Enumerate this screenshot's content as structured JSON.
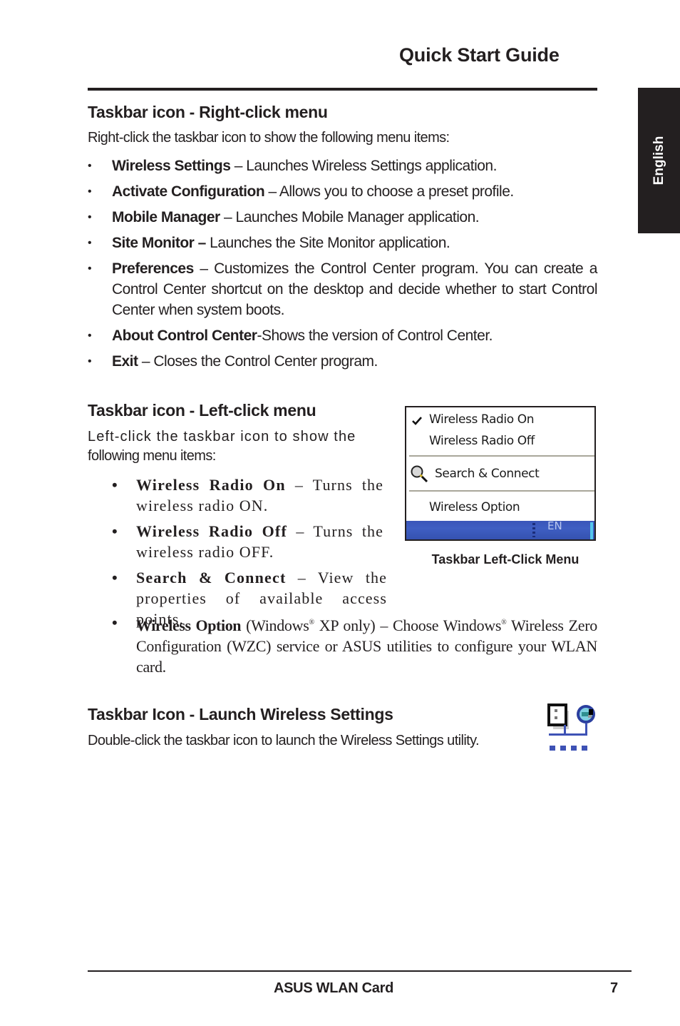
{
  "header": {
    "title": "Quick Start Guide"
  },
  "side_tab": {
    "label": "English"
  },
  "right_click_section": {
    "heading": "Taskbar icon - Right-click menu",
    "intro": "Right-click the taskbar icon to show the following menu items:",
    "items": [
      {
        "term": "Wireless Settings",
        "desc": " – Launches Wireless Settings application."
      },
      {
        "term": "Activate Configuration",
        "desc": " – Allows you to choose a preset profile."
      },
      {
        "term": "Mobile Manager",
        "desc": " – Launches Mobile Manager application."
      },
      {
        "term": "Site Monitor –",
        "desc": " Launches the Site Monitor application."
      },
      {
        "term": "Preferences",
        "desc": " – Customizes the Control Center program. You can create a Control Center shortcut on the desktop and decide whether to start Control Center when system boots."
      },
      {
        "term": "About Control Center",
        "desc": "-Shows the version of Control Center."
      },
      {
        "term": "Exit",
        "desc": " – Closes the Control Center program."
      }
    ]
  },
  "left_click_section": {
    "heading": "Taskbar icon - Left-click menu",
    "intro_line1": "Left-click the taskbar icon to show the",
    "intro_line2": "following menu items:",
    "items": [
      {
        "term": "Wireless Radio On",
        "desc": " – Turns the wireless radio ON."
      },
      {
        "term": "Wireless Radio Off",
        "desc": " – Turns the wireless radio OFF."
      },
      {
        "term": "Search & Connect",
        "desc": " – View the properties of available access points."
      }
    ],
    "wireless_option": {
      "term": "Wireless Option",
      "part1": " (Windows",
      "reg": "®",
      "part2": " XP only) – Choose Windows",
      "part3": " Wireless Zero Configuration (WZC) service or ASUS utilities to configure your WLAN card."
    },
    "menu_screenshot": {
      "items": [
        {
          "label": "Wireless Radio On",
          "icon": "check-icon"
        },
        {
          "label": "Wireless Radio Off",
          "icon": ""
        },
        {
          "label": "Search & Connect",
          "icon": "magnifier-icon"
        },
        {
          "label": "Wireless Option",
          "icon": ""
        }
      ],
      "taskbar_lang": "EN",
      "taskbar_color": "#3f5fc3"
    },
    "caption": "Taskbar Left-Click Menu"
  },
  "launch_section": {
    "heading": "Taskbar Icon - Launch Wireless Settings",
    "intro": "Double-click the taskbar icon to launch the Wireless Settings utility.",
    "icon": "wlan-taskbar-icon"
  },
  "footer": {
    "title": "ASUS WLAN Card",
    "page": "7"
  }
}
